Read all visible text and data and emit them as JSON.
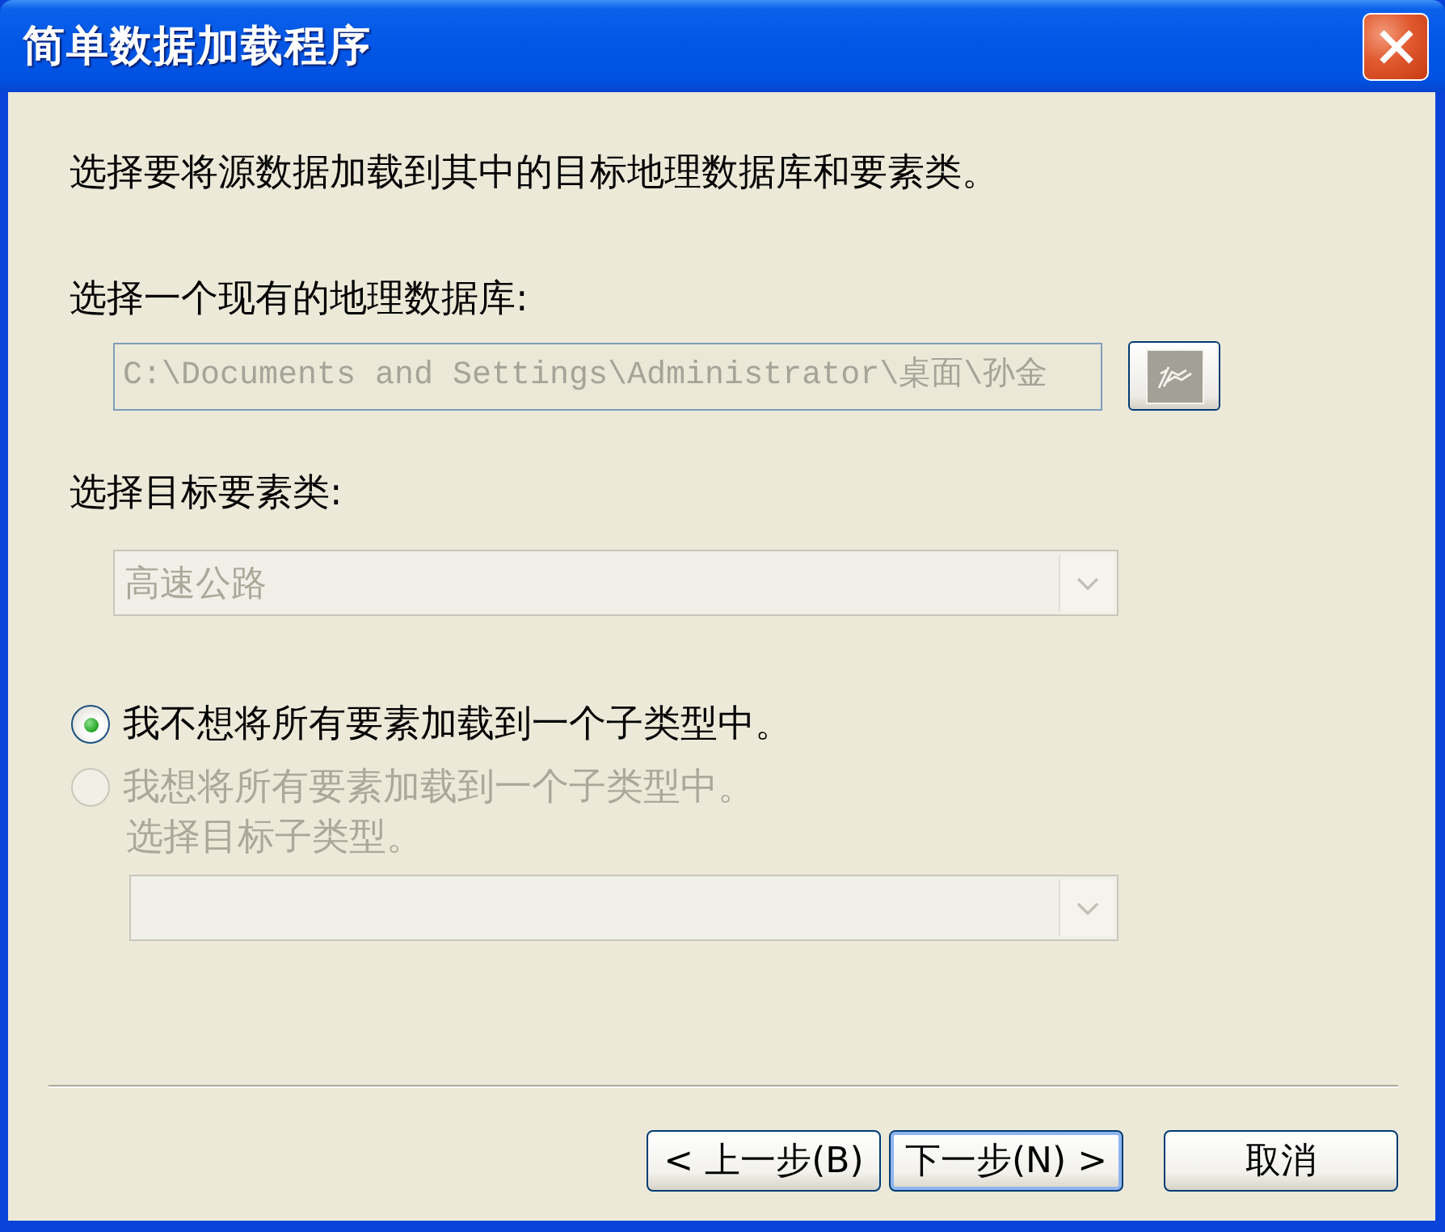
{
  "window": {
    "title": "简单数据加载程序"
  },
  "instruction": "选择要将源数据加载到其中的目标地理数据库和要素类。",
  "geodatabase": {
    "label": "选择一个现有的地理数据库:",
    "value": "C:\\Documents and Settings\\Administrator\\桌面\\孙金",
    "disabled": true
  },
  "feature_class": {
    "label": "选择目标要素类:",
    "value": "高速公路",
    "disabled": true
  },
  "options": [
    {
      "label": "我不想将所有要素加载到一个子类型中。",
      "selected": true,
      "disabled": false
    },
    {
      "label": "我想将所有要素加载到一个子类型中。",
      "selected": false,
      "disabled": true
    }
  ],
  "subtype": {
    "label": "选择目标子类型。",
    "disabled": true
  },
  "buttons": [
    {
      "label": "< 上一步(B)",
      "default": false
    },
    {
      "label": "下一步(N) >",
      "default": true
    },
    {
      "label": "取消",
      "default": false
    }
  ]
}
